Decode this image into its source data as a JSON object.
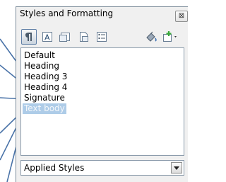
{
  "window": {
    "title": "Styles and Formatting",
    "close_glyph": "⊠"
  },
  "toolbar": {
    "buttons": [
      {
        "name": "paragraph-styles-icon",
        "active": true
      },
      {
        "name": "character-styles-icon",
        "active": false
      },
      {
        "name": "frame-styles-icon",
        "active": false
      },
      {
        "name": "page-styles-icon",
        "active": false
      },
      {
        "name": "list-styles-icon",
        "active": false
      },
      {
        "name": "fill-format-mode-icon",
        "active": false
      },
      {
        "name": "new-style-from-selection-icon",
        "active": false
      }
    ],
    "character_icon_letter": "A"
  },
  "styles": [
    "Default",
    "Heading",
    "Heading 3",
    "Heading 4",
    "Signature",
    "Text body"
  ],
  "selected_style": "Text body",
  "filter": {
    "value": "Applied Styles"
  },
  "colors": {
    "selection": "#aecce8",
    "annotation_arrow": "#4a73a8",
    "panel": "#f0f0f0"
  }
}
